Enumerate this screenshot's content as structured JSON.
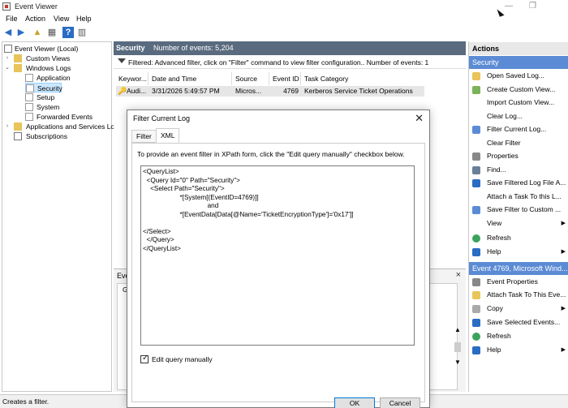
{
  "window": {
    "title": "Event Viewer",
    "minimize": "—",
    "maximize": "❐"
  },
  "menu": [
    "File",
    "Action",
    "View",
    "Help"
  ],
  "tree": {
    "items": [
      "Event Viewer (Local)",
      "Custom Views",
      "Windows Logs",
      "Application",
      "Security",
      "Setup",
      "System",
      "Forwarded Events",
      "Applications and Services Lo",
      "Subscriptions"
    ]
  },
  "center": {
    "header_log": "Security",
    "header_count": "Number of events: 5,204",
    "filter_text": "Filtered: Advanced filter, click on \"Filter\" command to view filter configuration.. Number of events: 1",
    "columns": [
      "Keywor...",
      "Date and Time",
      "Source",
      "Event ID",
      "Task Category"
    ],
    "row": {
      "keywords": "Audi...",
      "date": "3/31/2026 5:49:57 PM",
      "source": "Micros...",
      "event_id": "4769",
      "task": "Kerberos Service Ticket Operations"
    },
    "lower_title": "Eve",
    "lower_close": "×",
    "lower_tab": "G"
  },
  "actions": {
    "header": "Actions",
    "section1": "Security",
    "section1_items": [
      "Open Saved Log...",
      "Create Custom View...",
      "Import Custom View...",
      "Clear Log...",
      "Filter Current Log...",
      "Clear Filter",
      "Properties",
      "Find...",
      "Save Filtered Log File A...",
      "Attach a Task To this L...",
      "Save Filter to Custom ...",
      "View",
      "Refresh",
      "Help"
    ],
    "section2": "Event 4769, Microsoft Wind...",
    "section2_items": [
      "Event Properties",
      "Attach Task To This Eve...",
      "Copy",
      "Save Selected Events...",
      "Refresh",
      "Help"
    ]
  },
  "status": "Creates a filter.",
  "dialog": {
    "title": "Filter Current Log",
    "close": "✕",
    "tabs": [
      "Filter",
      "XML"
    ],
    "description": "To provide an event filter in XPath form, click the \"Edit query manually\" checkbox below.",
    "query": "<QueryList>\n  <Query Id=\"0\" Path=\"Security\">\n    <Select Path=\"Security\">\n                    *[System[(EventID=4769)]]\n                                   and\n                    *[EventData[Data[@Name='TicketEncryptionType']='0x17']]\n\n</Select>\n  </Query>\n</QueryList>",
    "checkbox_label": "Edit query manually",
    "ok": "OK",
    "cancel": "Cancel"
  }
}
